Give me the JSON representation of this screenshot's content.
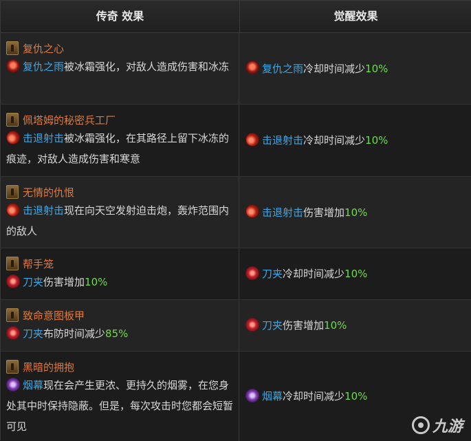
{
  "header": {
    "legendary_col": "传奇 效果",
    "awaken_col": "觉醒效果"
  },
  "colors": {
    "legendary_name": "#e07a3c",
    "skill_name": "#3aa7e8",
    "percent": "#6fdc4a"
  },
  "rows": [
    {
      "legend": "复仇之心",
      "legend_icon": "legendary-item-icon",
      "left_skill": "复仇之雨",
      "left_skill_icon": "rain-of-vengeance-icon",
      "left_desc": "被冰霜强化，对敌人造成伤害和冰冻",
      "right_skill": "复仇之雨",
      "right_text": "冷却时间减少",
      "right_pct": "10%"
    },
    {
      "legend": "佩塔姆的秘密兵工厂",
      "legend_icon": "legendary-item-icon",
      "left_skill": "击退射击",
      "left_skill_icon": "knockback-shot-icon",
      "left_desc": "被冰霜强化，在其路径上留下冰冻的痕迹，对敌人造成伤害和寒意",
      "right_skill": "击退射击",
      "right_text": "冷却时间减少",
      "right_pct": "10%"
    },
    {
      "legend": "无情的仇恨",
      "legend_icon": "legendary-item-icon",
      "left_skill": "击退射击",
      "left_skill_icon": "knockback-shot-icon",
      "left_desc": "现在向天空发射迫击炮，轰炸范围内的敌人",
      "right_skill": "击退射击",
      "right_text": "伤害增加",
      "right_pct": "10%"
    },
    {
      "legend": "帮手笼",
      "legend_icon": "legendary-item-icon",
      "left_skill": "刀夹",
      "left_skill_icon": "blade-trap-icon",
      "left_desc": "伤害增加",
      "left_pct": "10%",
      "right_skill": "刀夹",
      "right_text": "冷却时间减少",
      "right_pct": "10%"
    },
    {
      "legend": "致命意图板甲",
      "legend_icon": "legendary-item-icon",
      "left_skill": "刀夹",
      "left_skill_icon": "blade-trap-icon",
      "left_desc": "布防时间减少",
      "left_pct": "85%",
      "right_skill": "刀夹",
      "right_text": "伤害增加",
      "right_pct": "10%"
    },
    {
      "legend": "黑暗的拥抱",
      "legend_icon": "legendary-item-icon",
      "left_skill": "烟幕",
      "left_skill_icon": "smoke-screen-icon",
      "left_desc": "现在会产生更浓、更持久的烟雾，在您身处其中时保持隐蔽。但是，每次攻击时您都会短暂可见",
      "right_skill": "烟幕",
      "right_text": "冷却时间减少",
      "right_pct": "10%"
    }
  ],
  "watermark": {
    "text": "九游",
    "icon": "jiuyou-logo-icon"
  }
}
